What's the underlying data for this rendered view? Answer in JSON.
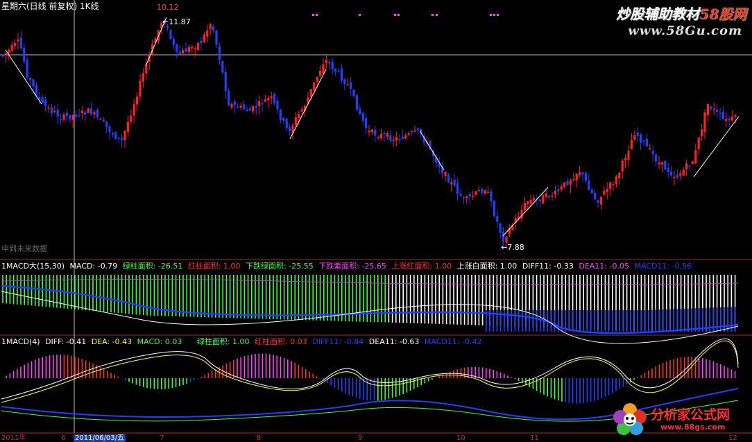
{
  "header": {
    "title": "星期六(日线 前复权) 1K线"
  },
  "main_panel": {
    "high_label": "10.12",
    "high_pointer": "11.87",
    "low_label": "7.88",
    "future_label": "申到未来数据"
  },
  "macd_big": {
    "name": "1MACD大(15,30)",
    "macd": "MACD: -0.79",
    "green_area": "绿柱面积: -26.51",
    "red_area": "红柱面积: 1.00",
    "down_green_area": "下跌绿面积: -25.55",
    "down_purple_area": "下跌紫面积: -25.65",
    "up_red_area": "上涨红面积: 1.00",
    "up_white_area": "上涨白面积: 1.00",
    "diff11": "DIFF11: -0.33",
    "dea11": "DEA11: -0.05",
    "macd11": "MACD11: -0.56"
  },
  "macd_small": {
    "name": "1MACD(4)",
    "diff": "DIFF: -0.41",
    "dea": "DEA: -0.43",
    "macd": "MACD: 0.03",
    "green_area": "绿柱面积: 1.00",
    "red_area": "红柱面积: 0.03",
    "diff11": "DIFF11: -0.84",
    "dea11": "DEA11: -0.63",
    "macd11": "MACD11: -0.42"
  },
  "xaxis": {
    "ticks": [
      "2011年",
      "6",
      "2011/06/03/五",
      "7",
      "8",
      "9",
      "10",
      "11",
      "12"
    ]
  },
  "watermark": {
    "line1_a": "炒股辅助教材",
    "line1_b": "58股网",
    "line2": "www.58Gu.com"
  },
  "logo": {
    "title": "分析家公式网",
    "url": "www.88gs.com"
  },
  "colors": {
    "up": "#ff2020",
    "down": "#2040ff",
    "green": "#40ff40",
    "purple": "#ff40ff",
    "white": "#ffffff",
    "yellow": "#ffff40",
    "label_bg": "#000000"
  },
  "chart_data": {
    "type": "candlestick",
    "note_days": 240,
    "price_range": [
      7.2,
      12.2
    ],
    "high": 10.12,
    "low": 7.88
  }
}
